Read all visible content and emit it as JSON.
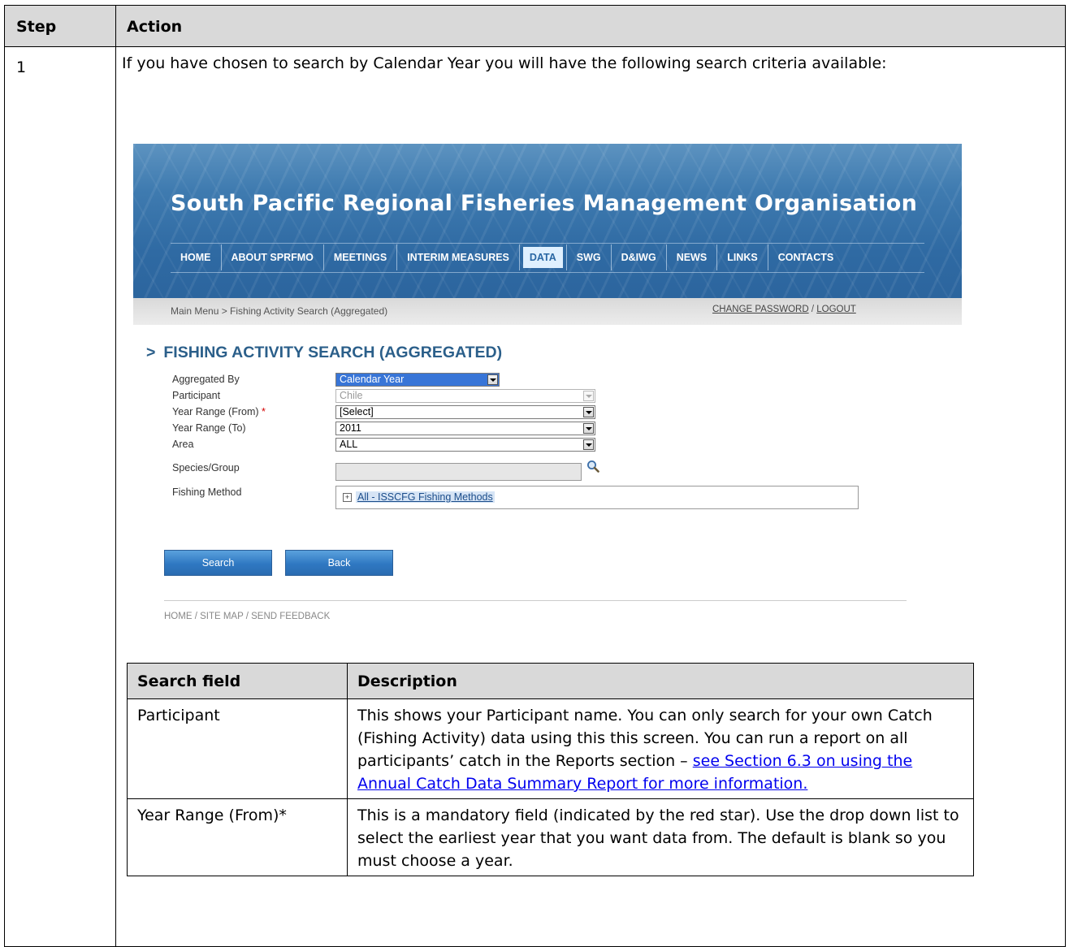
{
  "outer_table": {
    "col_step": "Step",
    "col_action": "Action",
    "step_number": "1",
    "intro": "If you have chosen to search by Calendar Year you will have the following search criteria available:"
  },
  "screenshot": {
    "site_title": "South Pacific Regional Fisheries Management Organisation",
    "nav": [
      "HOME",
      "ABOUT SPRFMO",
      "MEETINGS",
      "INTERIM MEASURES",
      "DATA",
      "SWG",
      "D&IWG",
      "NEWS",
      "LINKS",
      "CONTACTS"
    ],
    "nav_active": "DATA",
    "breadcrumb": "Main Menu > Fishing Activity Search (Aggregated)",
    "change_password": "CHANGE PASSWORD",
    "separator": " / ",
    "logout": "LOGOUT",
    "heading_chevron": ">",
    "heading": "FISHING ACTIVITY SEARCH (AGGREGATED)",
    "fields": {
      "aggregated_by_label": "Aggregated By",
      "aggregated_by_value": "Calendar Year",
      "participant_label": "Participant",
      "participant_value": "Chile",
      "year_from_label": "Year Range (From)",
      "year_from_required": "*",
      "year_from_value": "[Select]",
      "year_to_label": "Year Range (To)",
      "year_to_value": "2011",
      "area_label": "Area",
      "area_value": "ALL",
      "species_label": "Species/Group",
      "species_value": "",
      "method_label": "Fishing Method",
      "method_expand": "+",
      "method_value": "All - ISSCFG Fishing Methods"
    },
    "buttons": {
      "search": "Search",
      "back": "Back"
    },
    "footer": "HOME / SITE MAP / SEND FEEDBACK"
  },
  "desc_table": {
    "col_field": "Search field",
    "col_desc": "Description",
    "rows": [
      {
        "field": "Participant",
        "desc": "This shows your Participant name. You can only search for your own Catch (Fishing Activity) data using this this screen. You can run a report on all participants’ catch in the Reports section – ",
        "link": "see Section 6.3 on using the Annual Catch Data Summary Report for more information."
      },
      {
        "field": "Year Range (From)*",
        "desc": "This is a mandatory field (indicated by the red star). Use the drop down list to select the earliest year that you want data from. The default is blank so you must choose a year."
      }
    ]
  },
  "colors": {
    "banner_blue": "#2f6aa3",
    "heading_blue": "#2b5f8a",
    "selected_highlight": "#3875d7",
    "required_star": "#d40000",
    "header_gray": "#d9d9d9"
  },
  "icons": [
    "magnifier-icon",
    "dropdown-arrow-icon",
    "expand-plus-icon",
    "chevron-right-icon"
  ]
}
